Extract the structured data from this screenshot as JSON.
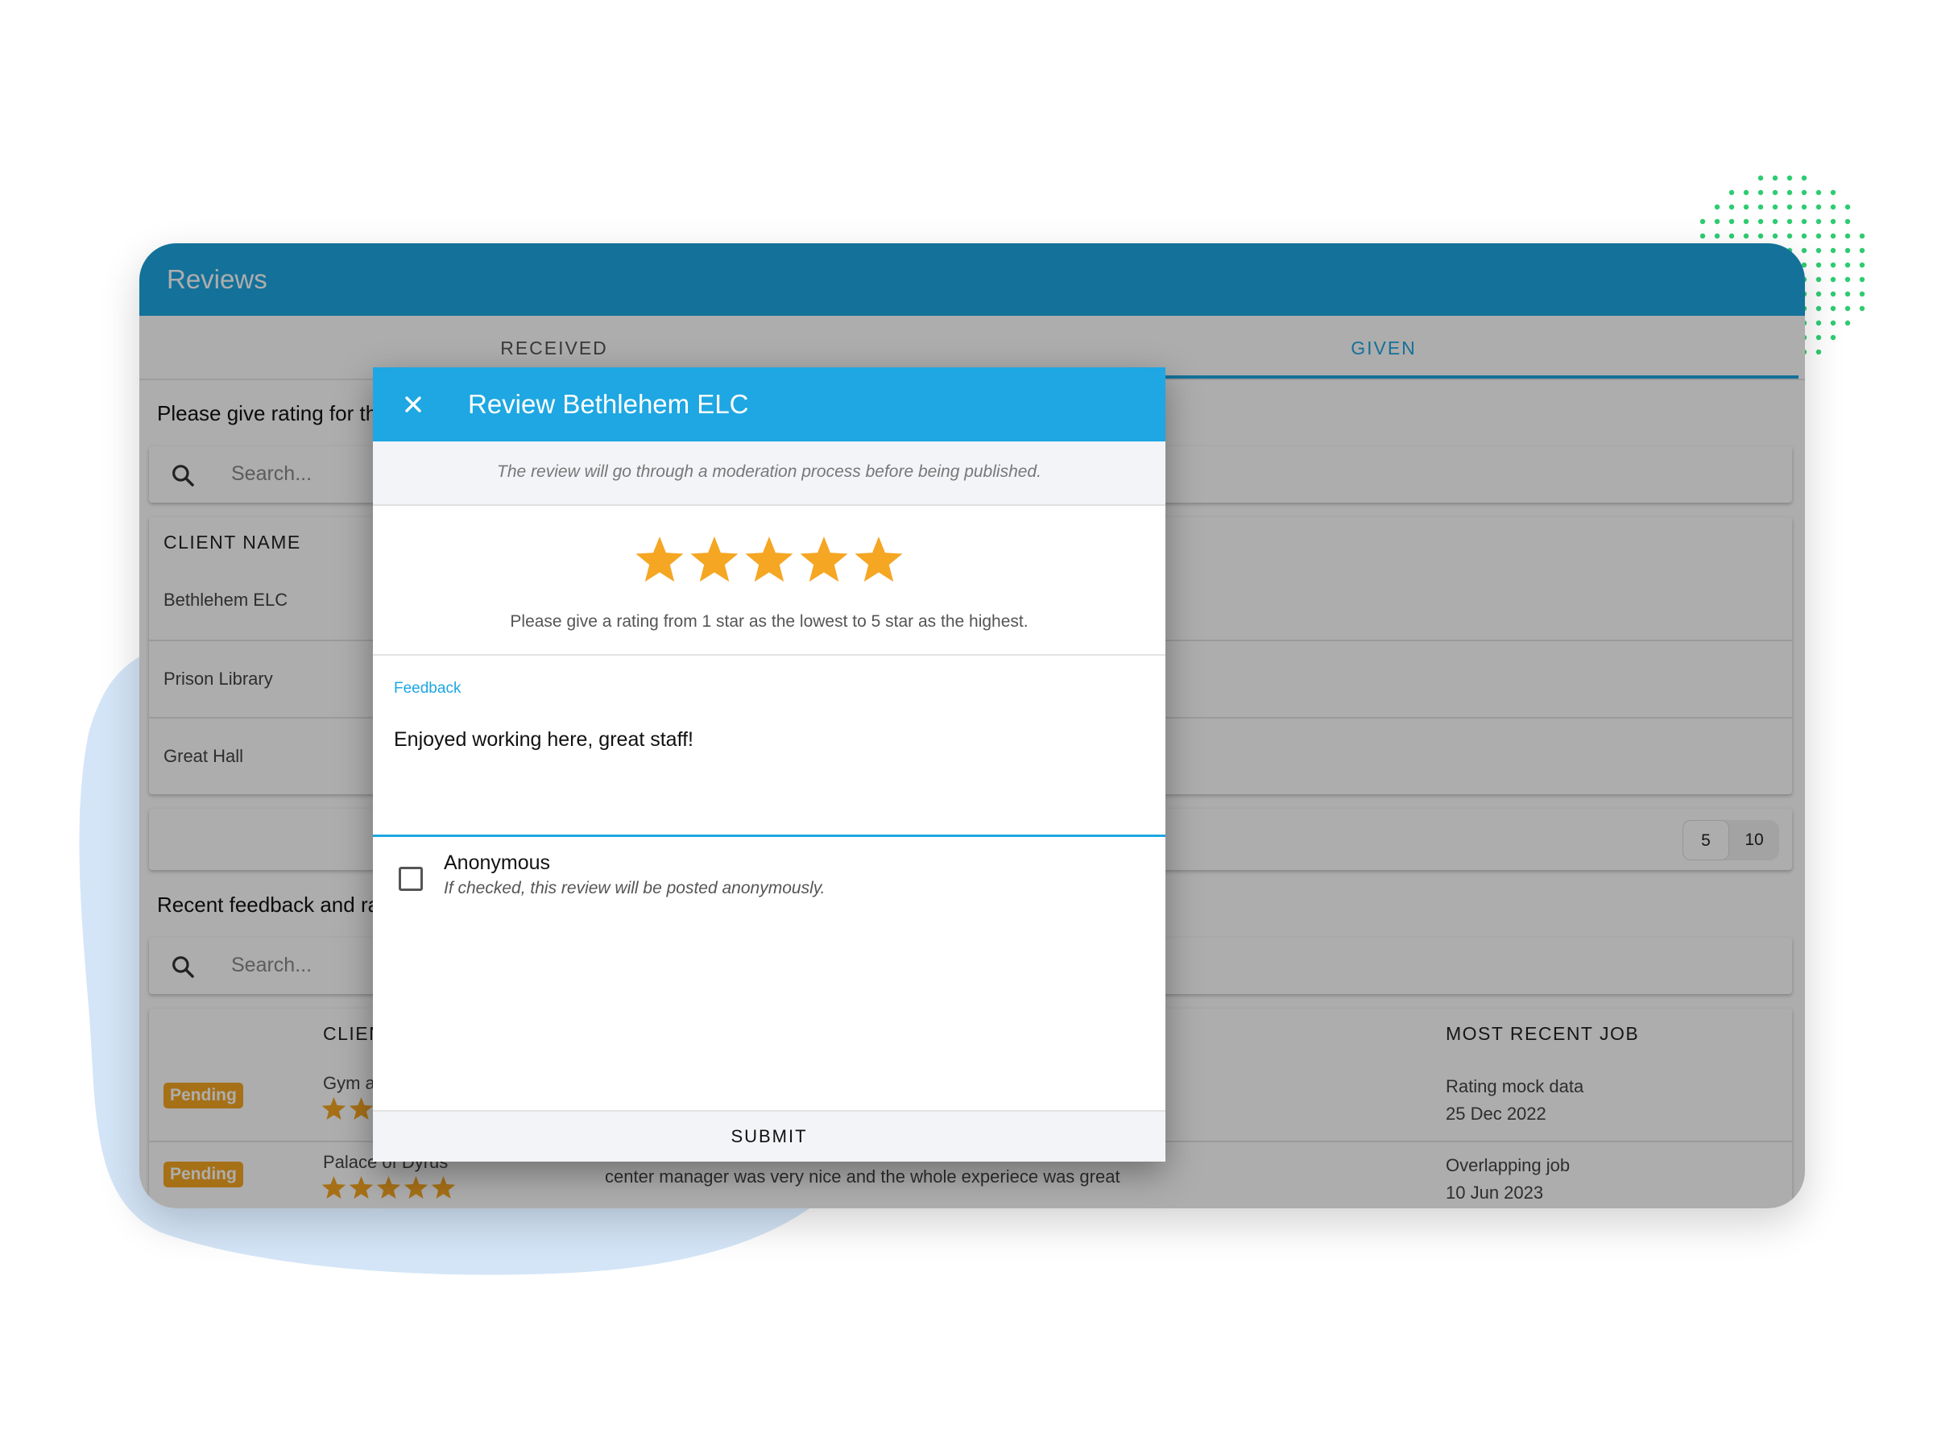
{
  "app": {
    "title": "Reviews"
  },
  "tabs": [
    {
      "label": "RECEIVED",
      "active": false
    },
    {
      "label": "GIVEN",
      "active": true
    }
  ],
  "pending_section": {
    "heading": "Please give rating for th",
    "search_placeholder": "Search...",
    "table_header": "CLIENT NAME",
    "clients": [
      "Bethlehem ELC",
      "Prison Library",
      "Great Hall"
    ],
    "page_size_options": [
      "5",
      "10"
    ],
    "selected_page_size": "5"
  },
  "recent_section": {
    "heading": "Recent feedback and ra",
    "search_placeholder": "Search...",
    "headers": {
      "client": "CLIEN",
      "recent_job": "MOST RECENT JOB"
    },
    "rows": [
      {
        "status": "Pending",
        "client": "Gym a",
        "rating": 2,
        "comment": "",
        "job_name": "Rating mock data",
        "job_date": "25 Dec 2022"
      },
      {
        "status": "Pending",
        "client": "Palace of Dyrus",
        "rating": 5,
        "comment": "center manager was very nice and the whole experiece was great",
        "job_name": "Overlapping job",
        "job_date": "10 Jun 2023"
      }
    ]
  },
  "modal": {
    "title": "Review Bethlehem ELC",
    "notice": "The review will go through a moderation process before being published.",
    "rating": 5,
    "rating_max": 5,
    "rating_hint": "Please give a rating from 1 star as the lowest to 5 star as the highest.",
    "feedback_label": "Feedback",
    "feedback_value": "Enjoyed working here, great staff!",
    "anonymous_label": "Anonymous",
    "anonymous_help": "If checked, this review will be posted anonymously.",
    "anonymous_checked": false,
    "submit_label": "SUBMIT"
  },
  "colors": {
    "primary": "#1ea7e2",
    "star": "#f5a623",
    "pending_badge": "#f5a623",
    "dots": "#2ecc71",
    "blob": "#d4e5f7"
  },
  "icons": {
    "close": "close-icon",
    "search": "search-icon",
    "star": "star-icon",
    "checkbox": "checkbox-icon"
  }
}
